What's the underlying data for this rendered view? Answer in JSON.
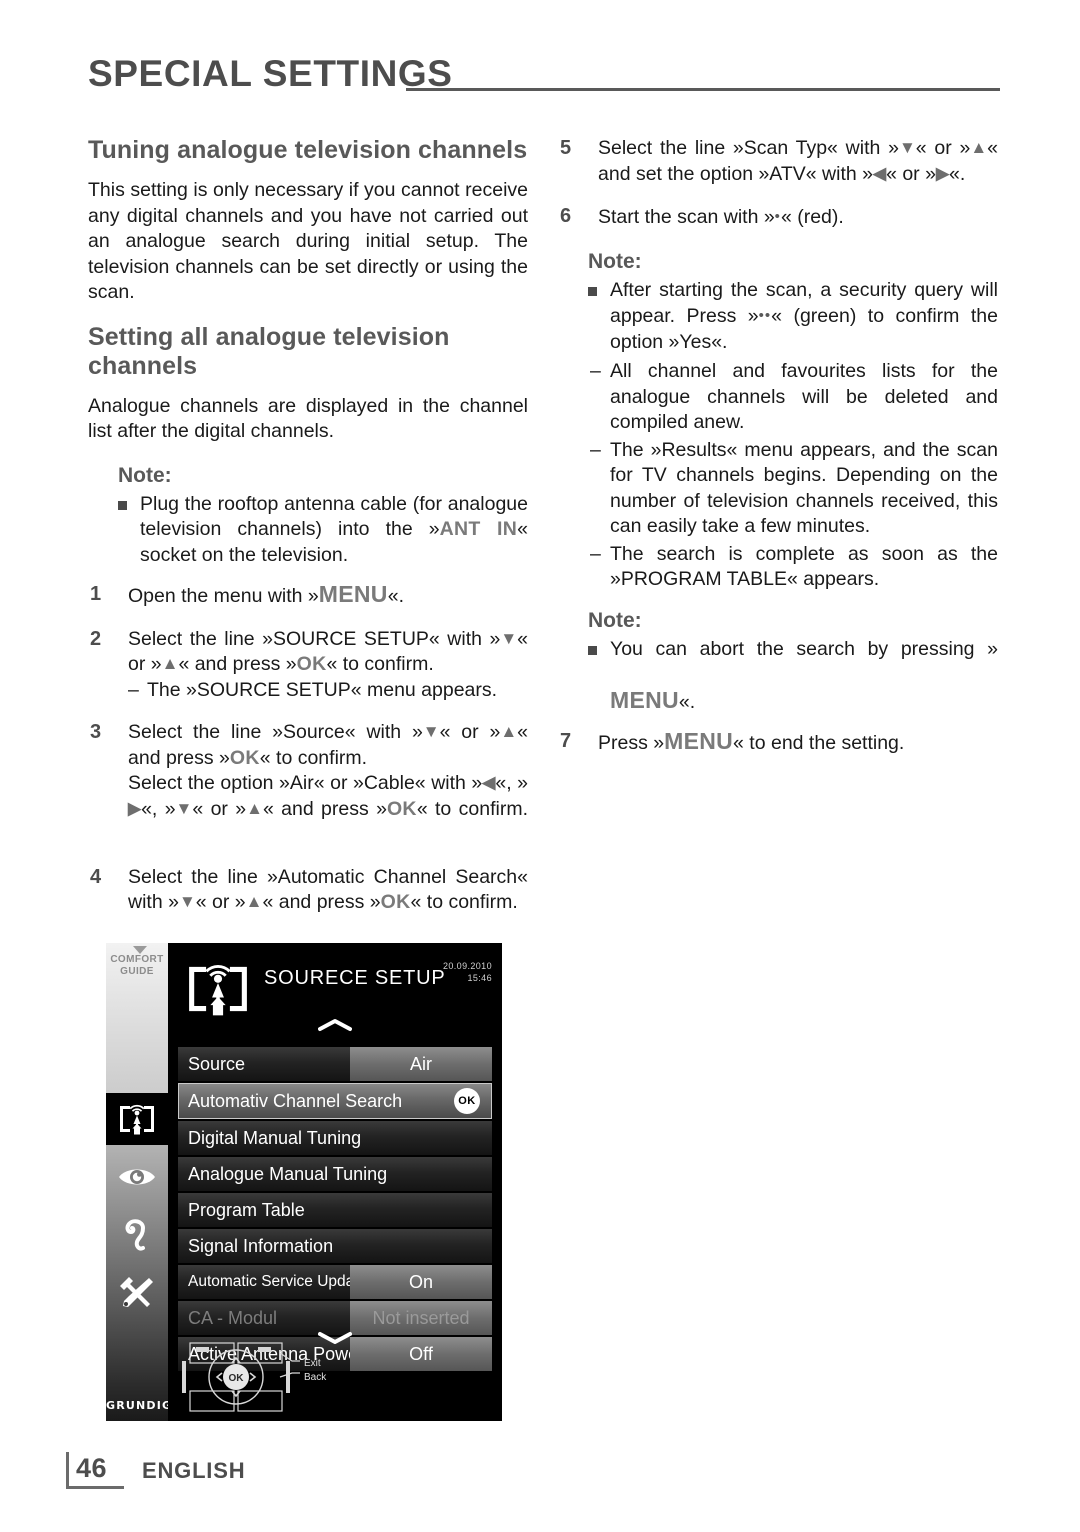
{
  "header": {
    "title": "SPECIAL SETTINGS"
  },
  "left_column": {
    "section1_heading": "Tuning analogue television channels",
    "section1_para": "This setting is only necessary if you cannot receive any digital channels and you have not carried out an analogue search during initial setup. The television channels can be set directly or using the scan.",
    "section2_heading": "Setting all analogue television channels",
    "section2_para": "Analogue channels are displayed in the channel list after the digital channels.",
    "note_label": "Note:",
    "note_item_part1": "Plug the rooftop antenna cable (for analogue television channels) into the »",
    "note_item_key": "ANT IN",
    "note_item_part2": "« socket on the television.",
    "steps": [
      {
        "num": "1",
        "t1": "Open the menu with »",
        "key1": "MENU",
        "t2": "«."
      },
      {
        "num": "2",
        "t1": "Select the line »SOURCE SETUP« with »",
        "a1": "▼",
        "t2": "« or »",
        "a2": "▲",
        "t3": "« and press »",
        "key1": "OK",
        "t4": "« to confirm.",
        "sub": "The »SOURCE SETUP« menu appears."
      },
      {
        "num": "3",
        "t1": "Select the line »Source« with »",
        "a1": "▼",
        "t2": "« or »",
        "a2": "▲",
        "t3": "« and press »",
        "key1": "OK",
        "t4": "« to confirm.",
        "t5": "Select the option »Air« or »Cable« with »",
        "a3": "◀",
        "t6": "«, »",
        "a4": "▶",
        "t7": "«, »",
        "a5": "▼",
        "t8": "« or »",
        "a6": "▲",
        "t9": "« and press »",
        "key2": "OK",
        "t10": "« to confirm."
      },
      {
        "num": "4",
        "t1": "Select the line »Automatic Channel Search« with »",
        "a1": "▼",
        "t2": "« or »",
        "a2": "▲",
        "t3": "« and press »",
        "key1": "OK",
        "t4": "« to confirm."
      }
    ]
  },
  "right_column": {
    "steps56": [
      {
        "num": "5",
        "t1": "Select the line »Scan Typ« with »",
        "a1": "▼",
        "t2": "« or »",
        "a2": "▲",
        "t3": "« and set the option »ATV« with »",
        "a3": "◀",
        "t4": "« or »",
        "a4": "▶",
        "t5": "«."
      },
      {
        "num": "6",
        "t1": "Start the scan with »",
        "dots": "•",
        "t2": "« (red)."
      }
    ],
    "note1_label": "Note:",
    "note1_item_p1": "After starting the scan, a security query will appear. Press »",
    "note1_item_dots": "••",
    "note1_item_p2": "« (green) to confirm the option »Yes«.",
    "note1_sub1": "All channel and favourites lists for the analogue channels will be deleted and compiled anew.",
    "note1_sub2": "The »Results« menu appears, and the scan for TV channels begins. Depending on the number of television channels received, this can easily take a few minutes.",
    "note1_sub3": "The search is complete as soon as the »PROGRAM TABLE« appears.",
    "note2_label": "Note:",
    "note2_item_p1": "You can abort the search by pressing »",
    "note2_item_key": "MENU",
    "note2_item_p2": "«.",
    "step7": {
      "num": "7",
      "t1": "Press »",
      "key1": "MENU",
      "t2": "« to end the setting."
    }
  },
  "tv_screenshot": {
    "sidebar": {
      "comfort_guide": "COMFORT\nGUIDE",
      "comfort_guide_line1": "COMFORT",
      "comfort_guide_line2": "GUIDE",
      "brand": "GRUNDIG",
      "icons": [
        "antenna-source-icon",
        "eye-picture-icon",
        "ear-sound-icon",
        "tools-settings-icon"
      ]
    },
    "menu_title": "SOURECE SETUP",
    "date": "20.09.2010",
    "time": "15:46",
    "rows": [
      {
        "label": "Source",
        "value": "Air",
        "type": "split",
        "state": "normal"
      },
      {
        "label": "Automativ Channel Search",
        "value": "OK",
        "type": "selected",
        "state": "selected"
      },
      {
        "label": "Digital Manual Tuning",
        "value": "",
        "type": "full",
        "state": "normal"
      },
      {
        "label": "Analogue Manual Tuning",
        "value": "",
        "type": "full",
        "state": "normal"
      },
      {
        "label": "Program Table",
        "value": "",
        "type": "full",
        "state": "normal"
      },
      {
        "label": "Signal Information",
        "value": "",
        "type": "full",
        "state": "normal"
      },
      {
        "label": "Automatic Service Update",
        "value": "On",
        "type": "split",
        "state": "small"
      },
      {
        "label": "CA - Modul",
        "value": "Not inserted",
        "type": "split",
        "state": "dim"
      },
      {
        "label": "Active Antenna Power",
        "value": "Off",
        "type": "split",
        "state": "normal"
      }
    ],
    "footer": {
      "exit": "Exit",
      "back": "Back",
      "ok": "OK"
    }
  },
  "page_footer": {
    "page_number": "46",
    "language": "ENGLISH"
  }
}
